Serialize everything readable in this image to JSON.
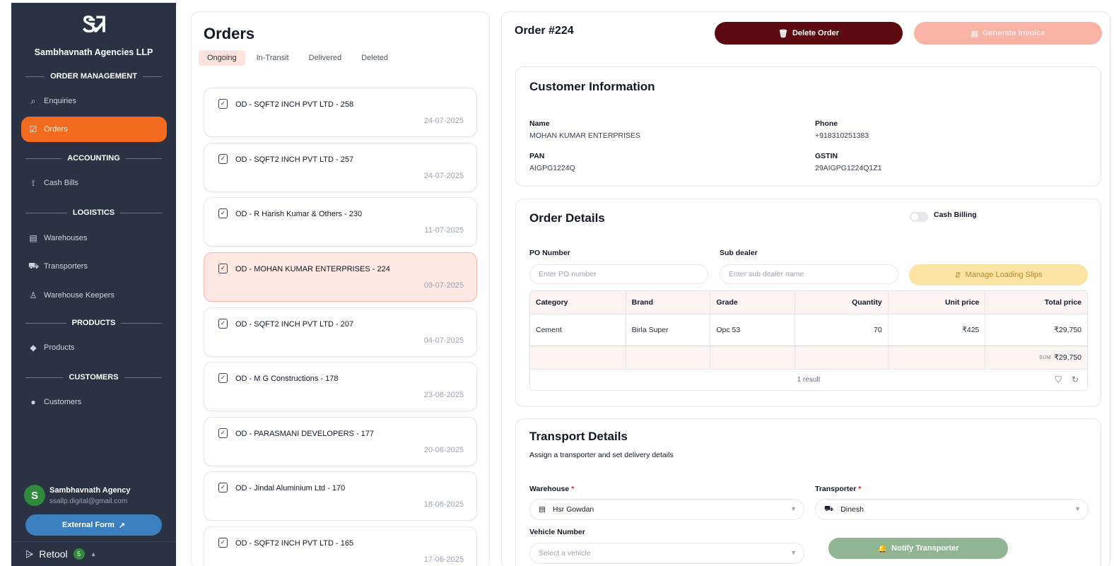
{
  "sidebar": {
    "brand_logo": "ᏕᏘ",
    "brand_name": "Sambhavnath Agencies LLP",
    "sections": [
      "ORDER MANAGEMENT",
      "ACCOUNTING",
      "LOGISTICS",
      "PRODUCTS",
      "CUSTOMERS"
    ],
    "items": [
      {
        "label": "Enquiries",
        "icon": "enquiries-icon"
      },
      {
        "label": "Orders",
        "icon": "orders-icon",
        "active": true
      },
      {
        "label": "Cash Bills",
        "icon": "cash-icon"
      },
      {
        "label": "Warehouses",
        "icon": "warehouse-icon"
      },
      {
        "label": "Transporters",
        "icon": "truck-icon"
      },
      {
        "label": "Warehouse Keepers",
        "icon": "keeper-icon"
      },
      {
        "label": "Products",
        "icon": "tag-icon"
      },
      {
        "label": "Customers",
        "icon": "user-icon"
      }
    ],
    "user": {
      "initial": "S",
      "name": "Sambhavnath Agency",
      "email": "ssallp.digital@gmail.com"
    },
    "external_form": "External Form",
    "retool": {
      "label": "Retool",
      "badge": "5"
    }
  },
  "orders": {
    "title": "Orders",
    "tabs": [
      "Ongoing",
      "In-Transit",
      "Delivered",
      "Deleted"
    ],
    "active_tab": "Ongoing",
    "list": [
      {
        "title": "OD - SQFT2 INCH PVT LTD - 258",
        "date": "24-07-2025"
      },
      {
        "title": "OD - SQFT2 INCH PVT LTD - 257",
        "date": "24-07-2025"
      },
      {
        "title": "OD - R Harish Kumar & Others - 230",
        "date": "11-07-2025"
      },
      {
        "title": "OD - MOHAN KUMAR ENTERPRISES - 224",
        "date": "09-07-2025",
        "selected": true
      },
      {
        "title": "OD - SQFT2 INCH PVT LTD - 207",
        "date": "04-07-2025"
      },
      {
        "title": "OD - M G Constructions - 178",
        "date": "23-06-2025"
      },
      {
        "title": "OD - PARASMANI DEVELOPERS - 177",
        "date": "20-06-2025"
      },
      {
        "title": "OD - Jindal Aluminium Ltd - 170",
        "date": "18-06-2025"
      },
      {
        "title": "OD - SQFT2 INCH PVT LTD - 165",
        "date": "17-06-2025"
      }
    ]
  },
  "detail": {
    "order_no": "Order #224",
    "delete_label": "Delete Order",
    "invoice_label": "Generate Invoice",
    "customer": {
      "title": "Customer Information",
      "name_label": "Name",
      "name": "MOHAN KUMAR ENTERPRISES",
      "phone_label": "Phone",
      "phone": "+918310251383",
      "pan_label": "PAN",
      "pan": "AIGPG1224Q",
      "gstin_label": "GSTIN",
      "gstin": "29AIGPG1224Q1Z1"
    },
    "order": {
      "title": "Order Details",
      "cash_billing": "Cash Billing",
      "po_label": "PO Number",
      "po_placeholder": "Enter PO number",
      "sub_label": "Sub dealer",
      "sub_placeholder": "Enter sub dealer name",
      "slips_label": "Manage Loading Slips",
      "columns": [
        "Category",
        "Brand",
        "Grade",
        "Quantity",
        "Unit price",
        "Total price"
      ],
      "rows": [
        [
          "Cement",
          "Birla Super",
          "Opc 53",
          "70",
          "₹425",
          "₹29,750"
        ]
      ],
      "sum_label": "SUM",
      "sum_value": "₹29,750",
      "result_text": "1 result"
    },
    "transport": {
      "title": "Transport Details",
      "subtitle": "Assign a transporter and set delivery details",
      "warehouse_label": "Warehouse",
      "warehouse_value": "Hsr Gowdan",
      "transporter_label": "Transporter",
      "transporter_value": "Dinesh",
      "vehicle_label": "Vehicle Number",
      "vehicle_placeholder": "Select a vehicle",
      "required_mark": "*",
      "notify_label": "Notify Transporter"
    }
  },
  "colors": {
    "sidebar_bg": "#2a3244",
    "accent": "#f26b1f",
    "delete": "#5c0a10",
    "invoice": "#f8b3a5",
    "slips": "#fbe3a4",
    "notify": "#8fb593"
  }
}
